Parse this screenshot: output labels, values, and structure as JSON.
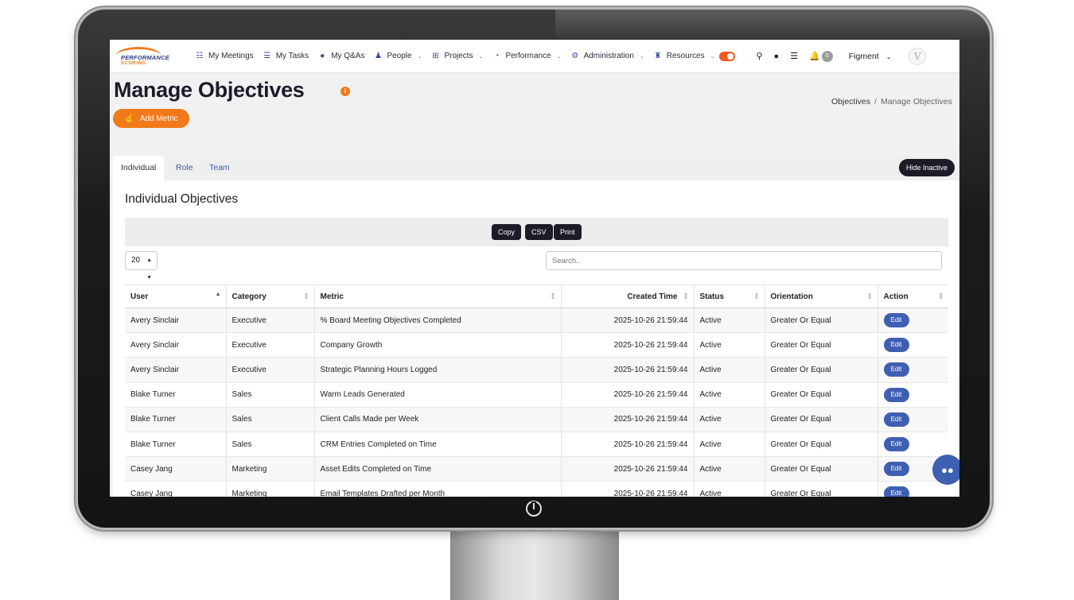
{
  "brand": {
    "line1": "PERFORMANCE",
    "line2": "SCORING"
  },
  "nav": {
    "items": [
      {
        "label": "My Meetings",
        "icon": "people-icon",
        "glyph": "☷",
        "caret": false
      },
      {
        "label": "My Tasks",
        "icon": "task-list-icon",
        "glyph": "☰",
        "caret": false
      },
      {
        "label": "My Q&As",
        "icon": "lightbulb-icon",
        "glyph": "●",
        "caret": false
      },
      {
        "label": "People",
        "icon": "users-icon",
        "glyph": "♟",
        "caret": true
      },
      {
        "label": "Projects",
        "icon": "sitemap-icon",
        "glyph": "⊞",
        "caret": true
      },
      {
        "label": "Performance",
        "icon": "gauge-icon",
        "glyph": "◔",
        "caret": true
      },
      {
        "label": "Administration",
        "icon": "gear-icon",
        "glyph": "⚙",
        "caret": true
      },
      {
        "label": "Resources",
        "icon": "user-tie-icon",
        "glyph": "♜",
        "caret": true
      }
    ],
    "bell_count": "0",
    "company": "Figment",
    "avatar_letter": "V"
  },
  "page": {
    "title": "Manage Objectives",
    "info_glyph": "i",
    "breadcrumb": {
      "parent": "Objectives",
      "current": "Manage Objectives"
    },
    "add_button": "Add Metric"
  },
  "tabs": {
    "individual": "Individual",
    "role": "Role",
    "team": "Team",
    "hide_inactive": "Hide Inactive"
  },
  "section_title": "Individual Objectives",
  "export": {
    "copy": "Copy",
    "csv": "CSV",
    "print": "Print"
  },
  "length_select": "20",
  "search": {
    "placeholder": "Search.."
  },
  "table": {
    "headers": [
      "User",
      "Category",
      "Metric",
      "Created Time",
      "Status",
      "Orientation",
      "Action"
    ],
    "edit_label": "Edit",
    "rows": [
      [
        "Avery Sinclair",
        "Executive",
        "% Board Meeting Objectives Completed",
        "2025-10-26 21:59:44",
        "Active",
        "Greater Or Equal"
      ],
      [
        "Avery Sinclair",
        "Executive",
        "Company Growth",
        "2025-10-26 21:59:44",
        "Active",
        "Greater Or Equal"
      ],
      [
        "Avery Sinclair",
        "Executive",
        "Strategic Planning Hours Logged",
        "2025-10-26 21:59:44",
        "Active",
        "Greater Or Equal"
      ],
      [
        "Blake Turner",
        "Sales",
        "Warm Leads Generated",
        "2025-10-26 21:59:44",
        "Active",
        "Greater Or Equal"
      ],
      [
        "Blake Turner",
        "Sales",
        "Client Calls Made per Week",
        "2025-10-26 21:59:44",
        "Active",
        "Greater Or Equal"
      ],
      [
        "Blake Turner",
        "Sales",
        "CRM Entries Completed on Time",
        "2025-10-26 21:59:44",
        "Active",
        "Greater Or Equal"
      ],
      [
        "Casey Jang",
        "Marketing",
        "Asset Edits Completed on Time",
        "2025-10-26 21:59:44",
        "Active",
        "Greater Or Equal"
      ],
      [
        "Casey Jang",
        "Marketing",
        "Email Templates Drafted per Month",
        "2025-10-26 21:59:44",
        "Active",
        "Greater Or Equal"
      ]
    ]
  },
  "colors": {
    "accent_orange": "#f07a1a",
    "primary_blue": "#3f5fb3",
    "dark_button": "#1c1c28"
  }
}
